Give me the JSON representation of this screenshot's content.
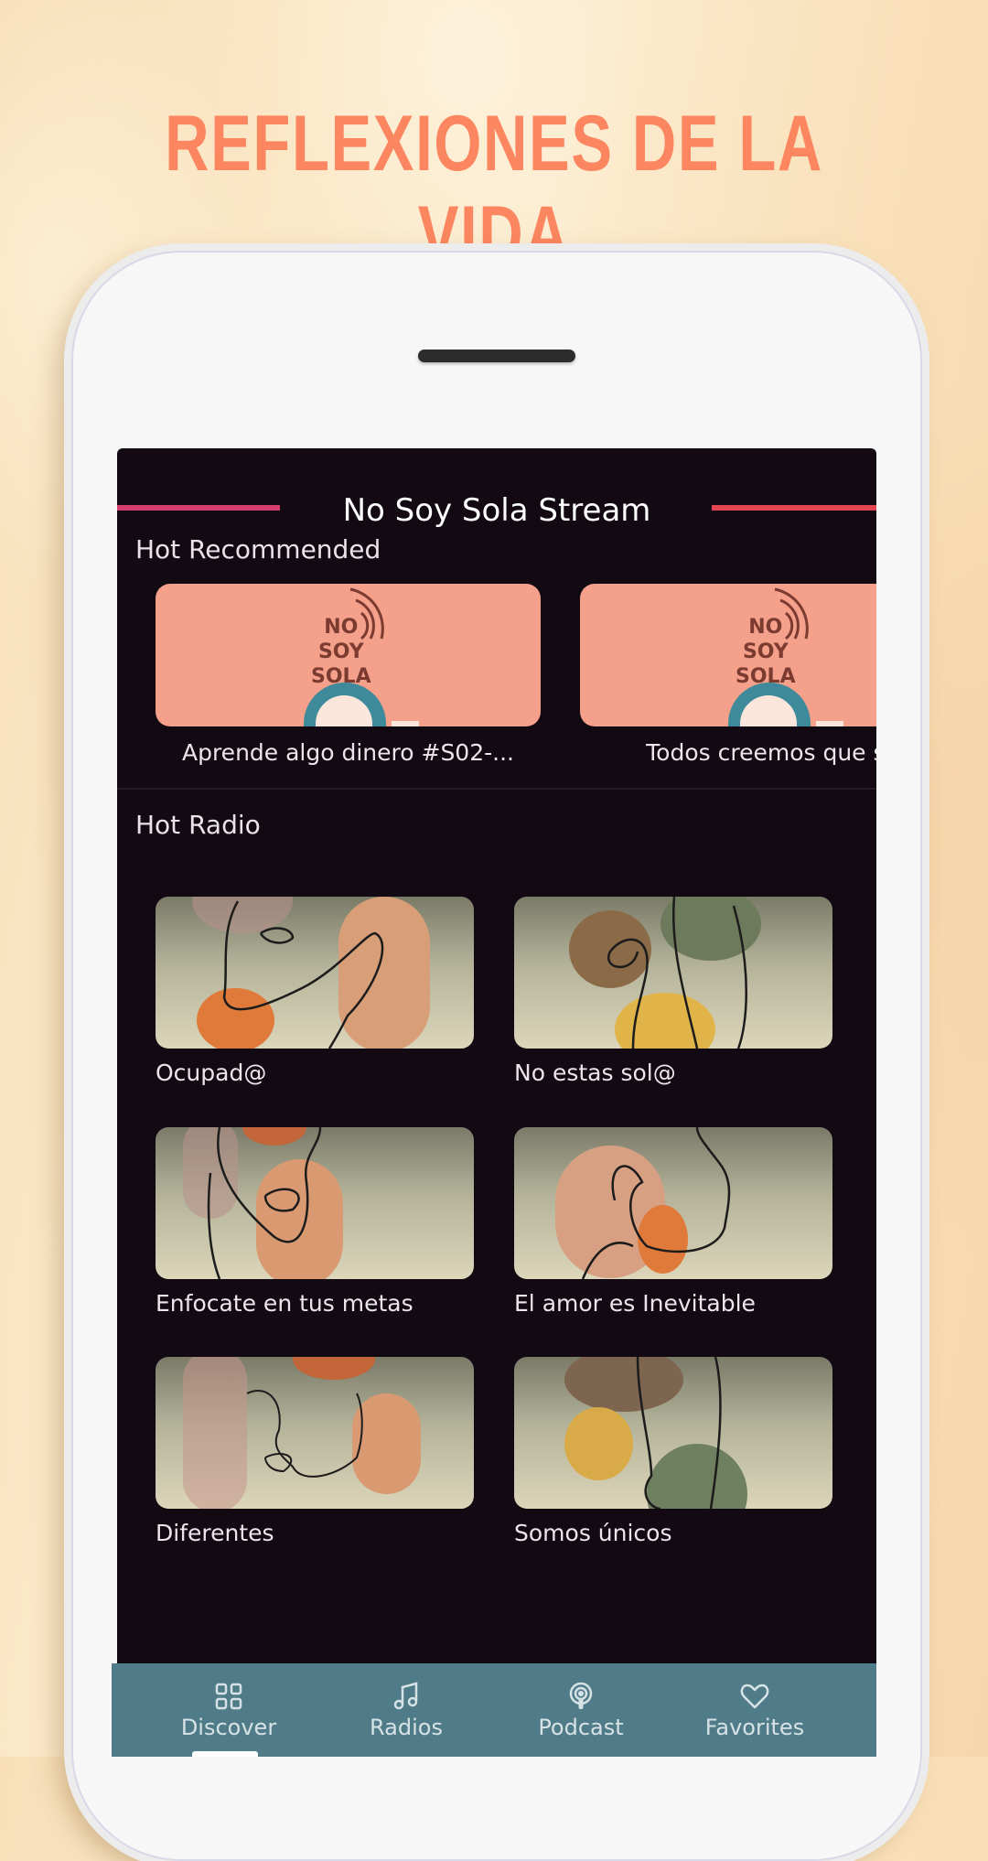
{
  "promo": {
    "headline": "REFLEXIONES DE LA VIDA",
    "headline_color": "#fb8660"
  },
  "app": {
    "title": "No Soy Sola Stream",
    "accent_left": "#d43f6e",
    "accent_right": "#e24452",
    "background": "#120913"
  },
  "hot_recommended": {
    "title": "Hot Recommended",
    "items": [
      {
        "caption": "Aprende algo dinero #S02-...",
        "logo_lines": [
          "NO",
          "SOY",
          "SOLA"
        ]
      },
      {
        "caption": "Todos creemos que so",
        "logo_lines": [
          "NO",
          "SOY",
          "SOLA"
        ]
      }
    ]
  },
  "hot_radio": {
    "title": "Hot Radio",
    "items": [
      {
        "caption": "Ocupad@"
      },
      {
        "caption": "No estas sol@"
      },
      {
        "caption": "Enfocate en tus metas"
      },
      {
        "caption": "El amor es Inevitable"
      },
      {
        "caption": "Diferentes"
      },
      {
        "caption": "Somos únicos"
      }
    ]
  },
  "bottom_nav": {
    "background": "#4f7c88",
    "active_index": 0,
    "items": [
      {
        "label": "Discover",
        "icon": "grid-icon"
      },
      {
        "label": "Radios",
        "icon": "music-note-icon"
      },
      {
        "label": "Podcast",
        "icon": "podcast-icon"
      },
      {
        "label": "Favorites",
        "icon": "heart-icon"
      }
    ]
  }
}
